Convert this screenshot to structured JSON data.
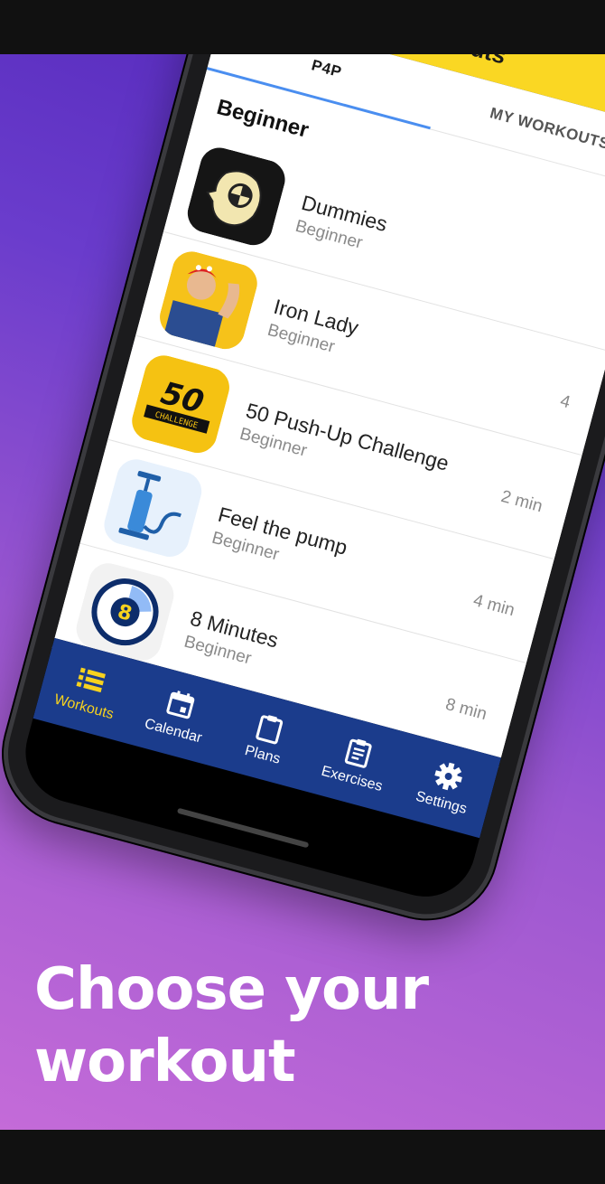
{
  "app": {
    "title": "Workouts"
  },
  "tabs": [
    {
      "label": "P4P"
    },
    {
      "label": "MY WORKOUTS"
    }
  ],
  "section": {
    "title": "Beginner"
  },
  "workouts": [
    {
      "title": "Dummies",
      "level": "Beginner",
      "time": "",
      "icon": "crash-test-dummy-icon"
    },
    {
      "title": "Iron Lady",
      "level": "Beginner",
      "time": "4",
      "icon": "rosie-riveter-icon"
    },
    {
      "title": "50 Push-Up Challenge",
      "level": "Beginner",
      "time": "2 min",
      "icon": "50-challenge-icon"
    },
    {
      "title": "Feel the pump",
      "level": "Beginner",
      "time": "4 min",
      "icon": "air-pump-icon"
    },
    {
      "title": "8 Minutes",
      "level": "Beginner",
      "time": "8 min",
      "icon": "timer-8-icon"
    }
  ],
  "nav": [
    {
      "label": "Workouts",
      "icon": "list-icon",
      "active": true
    },
    {
      "label": "Calendar",
      "icon": "calendar-icon",
      "active": false
    },
    {
      "label": "Plans",
      "icon": "clipboard-icon",
      "active": false
    },
    {
      "label": "Exercises",
      "icon": "checklist-icon",
      "active": false
    },
    {
      "label": "Settings",
      "icon": "gear-icon",
      "active": false
    }
  ],
  "headline": {
    "line1": "Choose your",
    "line2": "workout"
  },
  "colors": {
    "accent": "#fad723",
    "nav_bg": "#1b3c8c",
    "tab_indicator": "#4a8ef0",
    "gradient_top": "#5227b9",
    "gradient_bottom": "#c46bd8"
  }
}
